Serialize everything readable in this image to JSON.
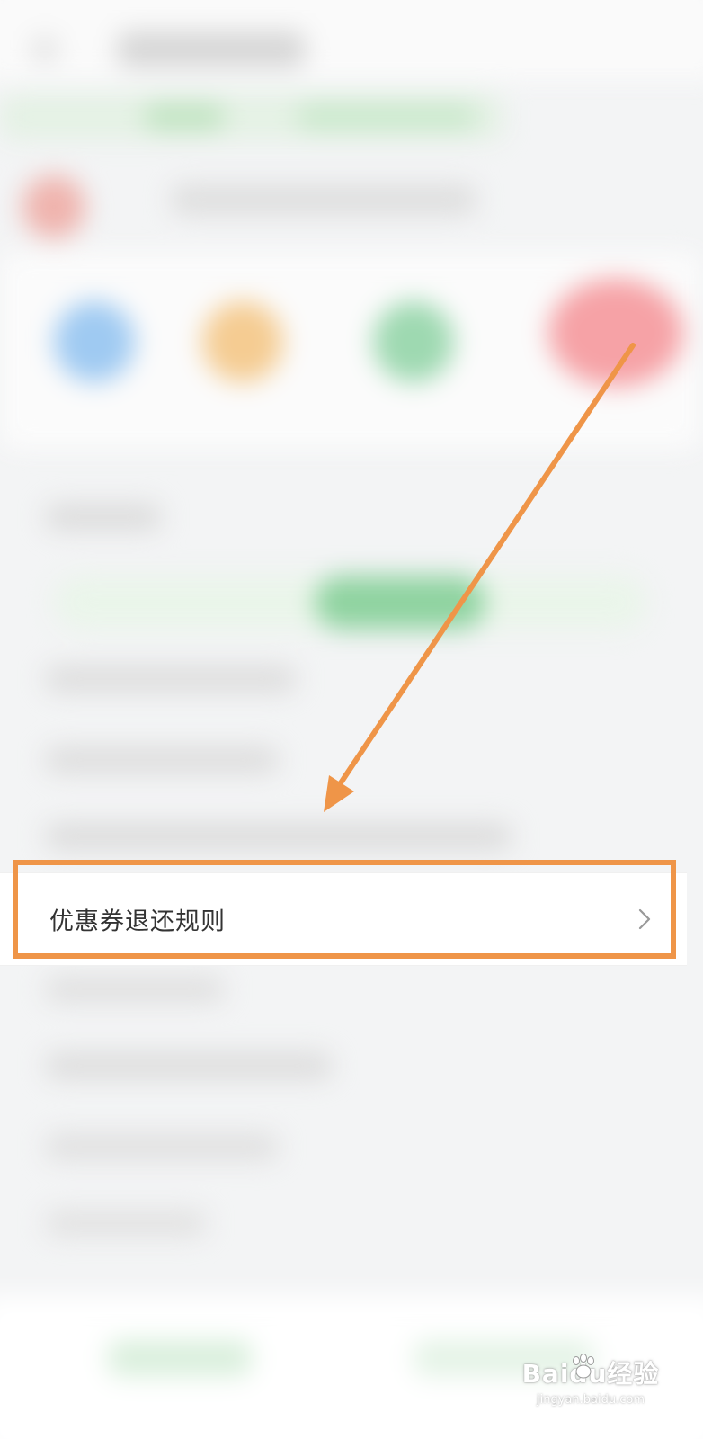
{
  "row": {
    "label": "优惠券退还规则",
    "chevron_icon": "chevron-right-icon"
  },
  "annotation": {
    "arrow_color": "#ef9548",
    "frame_color": "#ef9548"
  },
  "watermark": {
    "logo_text": "Baidu经验",
    "url_text": "jingyan.baidu.com"
  },
  "colors": {
    "background": "#f3f4f5",
    "row_background": "#ffffff",
    "text": "#333333"
  }
}
